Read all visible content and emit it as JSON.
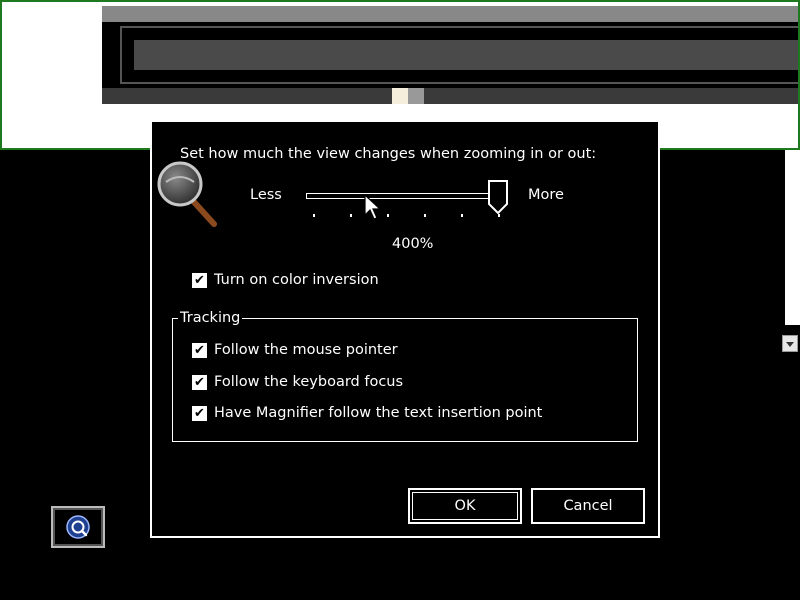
{
  "dialog": {
    "description": "Set how much the view changes when zooming in or out:",
    "slider": {
      "min_label": "Less",
      "max_label": "More",
      "value_text": "400%",
      "value_fraction": 1.0
    },
    "color_inversion": {
      "label": "Turn on color inversion",
      "checked": true
    },
    "tracking": {
      "legend": "Tracking",
      "items": [
        {
          "label": "Follow the mouse pointer",
          "checked": true
        },
        {
          "label": "Follow the keyboard focus",
          "checked": true
        },
        {
          "label": "Have Magnifier follow the text insertion point",
          "checked": true
        }
      ]
    },
    "buttons": {
      "ok": "OK",
      "cancel": "Cancel"
    }
  },
  "colors": {
    "background": "#000000",
    "foreground": "#ffffff",
    "lens_border": "#1f7a1f"
  },
  "icons": [
    "magnifier-icon",
    "checkmark-icon",
    "magnifier-taskbar-icon",
    "mouse-pointer-icon",
    "scroll-down-arrow-icon"
  ]
}
